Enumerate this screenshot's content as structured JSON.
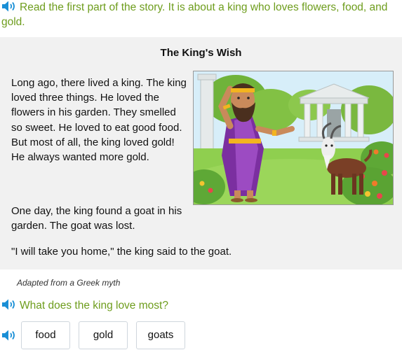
{
  "instruction": {
    "text": "Read the first part of the story. It is about a king who loves flowers, food, and gold.",
    "icon": "speaker-icon"
  },
  "story": {
    "title": "The King's Wish",
    "paragraphs": [
      "Long ago, there lived a king. The king loved three things. He loved the flowers in his garden. They smelled so sweet. He loved to eat good food. But most of all, the king loved gold! He always wanted more gold.",
      "One day, the king found a goat in his garden. The goat was lost.",
      "\"I will take you home,\" the king said to the goat."
    ],
    "source": "Adapted from a Greek myth"
  },
  "question": {
    "text": "What does the king love most?",
    "icon": "speaker-icon"
  },
  "answers": {
    "icon": "speaker-icon",
    "choices": [
      "food",
      "gold",
      "goats"
    ]
  },
  "colors": {
    "accent": "#6e9d1d",
    "speaker": "#1a8fd6",
    "story_background": "#f1f1f1"
  }
}
